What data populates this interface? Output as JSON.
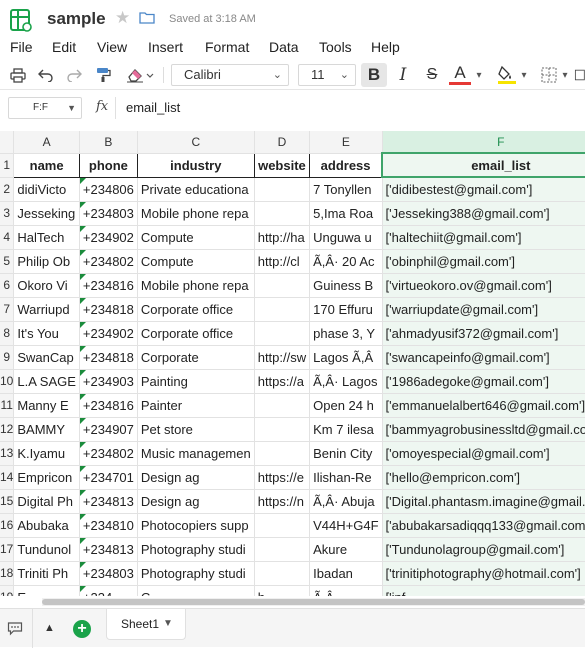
{
  "app": {
    "title": "sample",
    "saved_status": "Saved at 3:18 AM"
  },
  "menu": [
    "File",
    "Edit",
    "View",
    "Insert",
    "Format",
    "Data",
    "Tools",
    "Help"
  ],
  "toolbar": {
    "font": "Calibri",
    "font_size": "11",
    "bold_label": "B",
    "italic_label": "I",
    "strike_label": "S",
    "text_color_label": "A",
    "text_color": "#e53935",
    "fill_color": "#f6e400",
    "accent": "#1aa34a"
  },
  "formula_bar": {
    "cell_ref": "F:F",
    "fx_label": "fx",
    "value": "email_list"
  },
  "grid": {
    "columns": [
      "A",
      "B",
      "C",
      "D",
      "E",
      "F",
      "G"
    ],
    "selected_column": "F",
    "headers": [
      "name",
      "phone",
      "industry",
      "website",
      "address",
      "email_list"
    ],
    "rows": [
      {
        "n": "1"
      },
      {
        "n": "2",
        "cells": [
          "didiVicto",
          "+234806",
          "Private educationa",
          "",
          "7 Tonyllen",
          "['didibestest@gmail.com']"
        ]
      },
      {
        "n": "3",
        "cells": [
          "Jesseking",
          "+234803",
          "Mobile phone repa",
          "",
          "5,Ima Roa",
          "['Jesseking388@gmail.com']"
        ]
      },
      {
        "n": "4",
        "cells": [
          "HalTech",
          "+234902",
          "Compute",
          "http://ha",
          "Unguwa u",
          "['haltechiit@gmail.com']"
        ]
      },
      {
        "n": "5",
        "cells": [
          "Philip Ob",
          "+234802",
          "Compute",
          "http://cl",
          "Ã,Â· 20 Ac",
          "['obinphil@gmail.com']"
        ]
      },
      {
        "n": "6",
        "cells": [
          "Okoro Vi",
          "+234816",
          "Mobile phone repa",
          "",
          "Guiness B",
          "['virtueokoro.ov@gmail.com']"
        ]
      },
      {
        "n": "7",
        "cells": [
          "Warriupd",
          "+234818",
          "Corporate office",
          "",
          "170 Effuru",
          "['warriupdate@gmail.com']"
        ]
      },
      {
        "n": "8",
        "cells": [
          "It's You",
          "+234902",
          "Corporate office",
          "",
          "phase 3, Y",
          "['ahmadyusif372@gmail.com']"
        ]
      },
      {
        "n": "9",
        "cells": [
          "SwanCap",
          "+234818",
          "Corporate",
          "http://sw",
          "Lagos Ã,Â",
          "['swancapeinfo@gmail.com']"
        ]
      },
      {
        "n": "10",
        "cells": [
          "L.A SAGE",
          "+234903",
          "Painting",
          "https://a",
          "Ã,Â· Lagos",
          "['1986adegoke@gmail.com']"
        ]
      },
      {
        "n": "11",
        "cells": [
          "Manny E",
          "+234816",
          "Painter",
          "",
          "Open 24 h",
          "['emmanuelalbert646@gmail.com']"
        ]
      },
      {
        "n": "12",
        "cells": [
          "BAMMY",
          "+234907",
          "Pet store",
          "",
          "Km 7 ilesa",
          "['bammyagrobusinessltd@gmail.com']"
        ]
      },
      {
        "n": "13",
        "cells": [
          "K.Iyamu",
          "+234802",
          "Music managemen",
          "",
          "Benin City",
          "['omoyespecial@gmail.com']"
        ]
      },
      {
        "n": "14",
        "cells": [
          "Empricon",
          "+234701",
          "Design ag",
          "https://e",
          "Ilishan-Re",
          "['hello@empricon.com']"
        ]
      },
      {
        "n": "15",
        "cells": [
          "Digital Ph",
          "+234813",
          "Design ag",
          "https://n",
          "Ã,Â· Abuja",
          "['Digital.phantasm.imagine@gmail.com']"
        ]
      },
      {
        "n": "16",
        "cells": [
          "Abubaka",
          "+234810",
          "Photocopiers supp",
          "",
          "V44H+G4F",
          "['abubakarsadiqqq133@gmail.com']"
        ]
      },
      {
        "n": "17",
        "cells": [
          "Tundunol",
          "+234813",
          "Photography studi",
          "",
          "Akure",
          "['Tundunolagroup@gmail.com']"
        ]
      },
      {
        "n": "18",
        "cells": [
          "Triniti Ph",
          "+234803",
          "Photography studi",
          "",
          "Ibadan",
          "['trinitiphotography@hotmail.com']"
        ]
      },
      {
        "n": "19",
        "cells": [
          "E",
          "+234",
          "C",
          "h",
          "Ã,Â·",
          "['inf"
        ]
      }
    ]
  },
  "sheets": {
    "active": "Sheet1"
  }
}
